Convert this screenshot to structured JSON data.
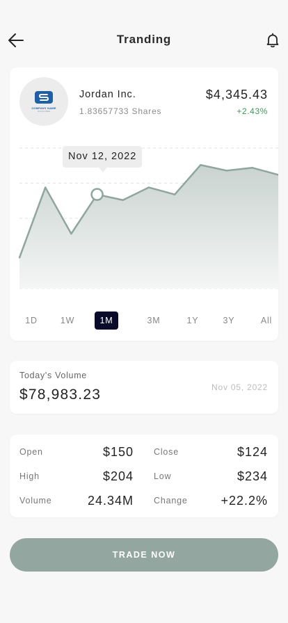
{
  "header": {
    "title": "Tranding"
  },
  "company": {
    "name": "Jordan Inc.",
    "shares": "1.83657733 Shares",
    "price": "$4,345.43",
    "change": "+2.43%",
    "logo_caption": "COMPANY NAME",
    "logo_sub": "SLOGAN HERE"
  },
  "chart_data": {
    "type": "area",
    "x": [
      0,
      1,
      2,
      3,
      4,
      5,
      6,
      7,
      8,
      9,
      10
    ],
    "values": [
      22,
      72,
      39,
      67,
      63,
      72,
      67,
      88,
      84,
      86,
      81
    ],
    "ylim": [
      0,
      100
    ],
    "tooltip": "Nov 12, 2022",
    "grid": true,
    "colors": {
      "line": "#8fa59e",
      "fill_top": "#c9d3cf",
      "fill_bottom": "#f4f6f5",
      "accent": "#0a0a2a",
      "positive": "#3b9b57"
    }
  },
  "ranges": {
    "items": [
      "1D",
      "1W",
      "1M",
      "3M",
      "1Y",
      "3Y",
      "All"
    ],
    "active": "1M"
  },
  "volume": {
    "label": "Today's Volume",
    "value": "$78,983.23",
    "date": "Nov 05, 2022"
  },
  "stats": {
    "open_label": "Open",
    "open_value": "$150",
    "close_label": "Close",
    "close_value": "$124",
    "high_label": "High",
    "high_value": "$204",
    "low_label": "Low",
    "low_value": "$234",
    "volume_label": "Volume",
    "volume_value": "24.34M",
    "change_label": "Change",
    "change_value": "+22.2%"
  },
  "cta": {
    "label": "TRADE NOW"
  },
  "icons": {
    "back": "back-arrow-icon",
    "bell": "bell-icon"
  }
}
